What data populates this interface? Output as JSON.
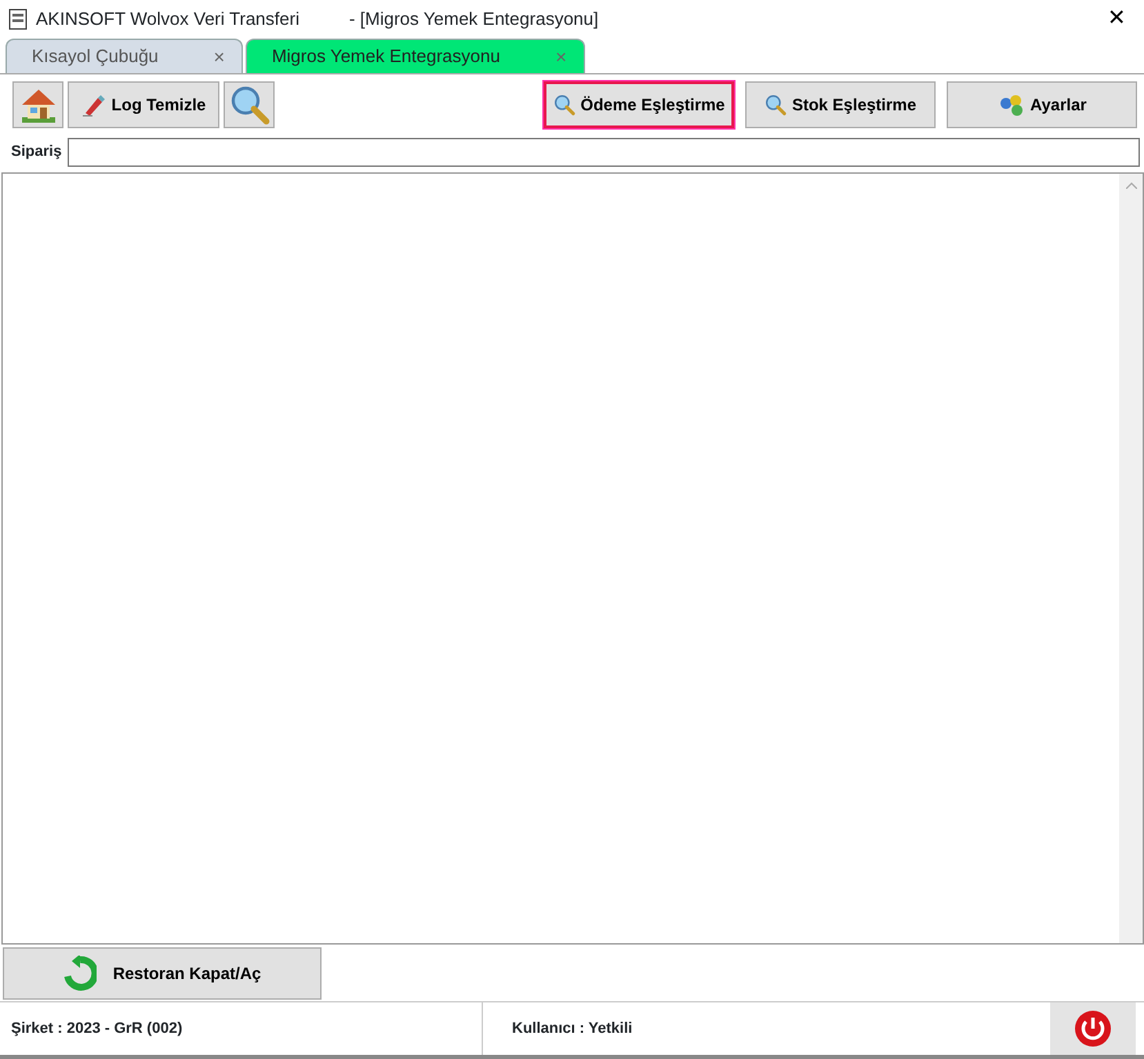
{
  "window": {
    "title": "AKINSOFT Wolvox Veri Transferi",
    "subtitle": "- [Migros Yemek Entegrasyonu]",
    "close": "✕"
  },
  "tabs": [
    {
      "label": "Kısayol Çubuğu",
      "close": "×",
      "selected": false
    },
    {
      "label": "Migros Yemek Entegrasyonu",
      "close": "×",
      "selected": true
    }
  ],
  "toolbar": [
    {
      "kind": "icon"
    },
    {
      "kind": "text",
      "label": "Log Temizle",
      "focused": false
    },
    {
      "kind": "icon"
    },
    {
      "kind": "spacer"
    },
    {
      "kind": "text",
      "label": "Ödeme Eşleştirme",
      "focused": true
    },
    {
      "kind": "text",
      "label": "Stok Eşleştirme",
      "focused": false
    },
    {
      "kind": "text",
      "label": "Ayarlar",
      "focused": false
    }
  ],
  "order_field": {
    "label": "Sipariş"
  },
  "bottom_button": {
    "label": "Restoran Kapat/Aç"
  },
  "status_bar": {
    "company": "Şirket : 2023 - GrR (002)",
    "user": "Kullanıcı : Yetkili"
  }
}
